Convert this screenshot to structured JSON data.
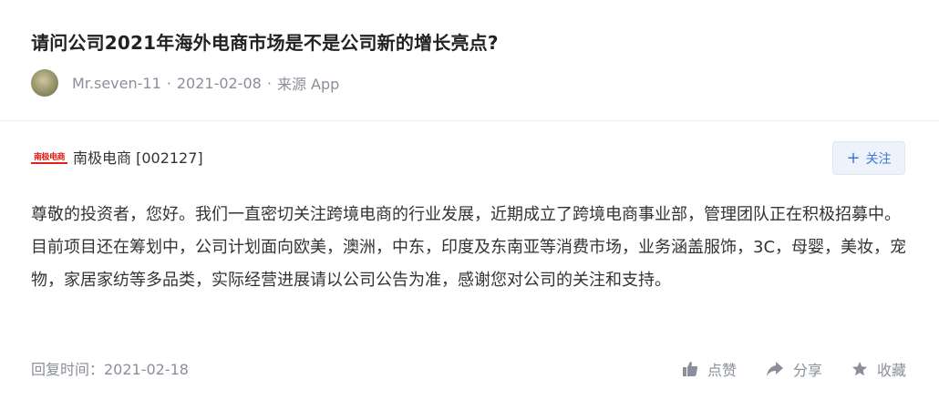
{
  "question": {
    "title": "请问公司2021年海外电商市场是不是公司新的增长亮点?"
  },
  "meta": {
    "username": "Mr.seven-11",
    "date": "2021-02-08",
    "source": "来源 App"
  },
  "company": {
    "logo_text": "南极电商",
    "name_code": "南极电商 [002127]",
    "follow_label": "关注"
  },
  "answer": {
    "text": "尊敬的投资者，您好。我们一直密切关注跨境电商的行业发展，近期成立了跨境电商事业部，管理团队正在积极招募中。目前项目还在筹划中，公司计划面向欧美，澳洲，中东，印度及东南亚等消费市场，业务涵盖服饰，3C，母婴，美妆，宠物，家居家纺等多品类，实际经营进展请以公司公告为准，感谢您对公司的关注和支持。",
    "reply_time": "回复时间：2021-02-18"
  },
  "actions": {
    "like_label": "点赞",
    "share_label": "分享",
    "favorite_label": "收藏"
  },
  "colors": {
    "accent": "#3d78d8",
    "muted": "#8a8f99",
    "logo_red": "#e0201a"
  }
}
